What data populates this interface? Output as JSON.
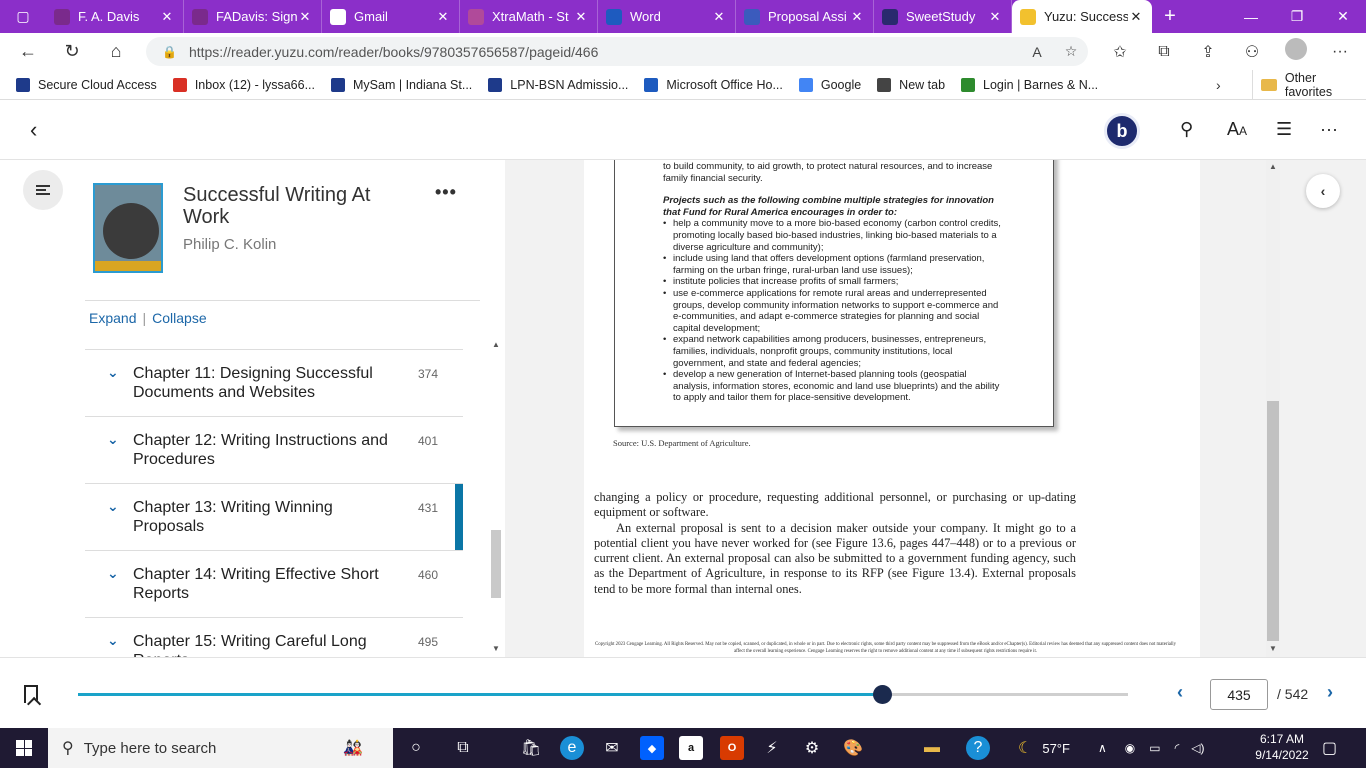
{
  "browser": {
    "tabs": [
      {
        "title": "F. A. Davis",
        "color": "#7a2a8c"
      },
      {
        "title": "FADavis: Sign",
        "color": "#7a2a8c"
      },
      {
        "title": "Gmail",
        "color": "#ffffff"
      },
      {
        "title": "XtraMath - St",
        "color": "#b04a9a"
      },
      {
        "title": "Word",
        "color": "#1e5bbf"
      },
      {
        "title": "Proposal Assi",
        "color": "#3b5bbd"
      },
      {
        "title": "SweetStudy",
        "color": "#2a2a6e"
      },
      {
        "title": "Yuzu: Success",
        "color": "#f2c12e"
      }
    ],
    "url": "https://reader.yuzu.com/reader/books/9780357656587/pageid/466",
    "favorites": [
      {
        "label": "Secure Cloud Access",
        "color": "#1e3a8a"
      },
      {
        "label": "Inbox (12) - lyssa66...",
        "color": "#d93025"
      },
      {
        "label": "MySam | Indiana St...",
        "color": "#1e3a8a"
      },
      {
        "label": "LPN-BSN Admissio...",
        "color": "#1e3a8a"
      },
      {
        "label": "Microsoft Office Ho...",
        "color": "#1e5bbf"
      },
      {
        "label": "Google",
        "color": "#4285f4"
      },
      {
        "label": "New tab",
        "color": "#444444"
      },
      {
        "label": "Login | Barnes & N...",
        "color": "#2e8b2e"
      }
    ],
    "other_favorites": "Other favorites"
  },
  "app": {
    "brand_letter": "b"
  },
  "book": {
    "title": "Successful Writing At Work",
    "author": "Philip C. Kolin",
    "expand": "Expand",
    "collapse": "Collapse",
    "separator": "|"
  },
  "toc": [
    {
      "title": "Chapter 11: Designing Successful Documents and Websites",
      "page": "374"
    },
    {
      "title": "Chapter 12: Writing Instructions and Procedures",
      "page": "401"
    },
    {
      "title": "Chapter 13: Writing Winning Proposals",
      "page": "431"
    },
    {
      "title": "Chapter 14: Writing Effective Short Reports",
      "page": "460"
    },
    {
      "title": "Chapter 15: Writing Careful Long Reports",
      "page": "495"
    }
  ],
  "page": {
    "fig_intro": "to build community, to aid growth, to protect natural resources, and to increase family financial security.",
    "fig_heading": "Projects such as the following combine multiple strategies for innovation that Fund for Rural America encourages in order to:",
    "fig_bullets": [
      "help a community move to a more bio-based economy (carbon control credits, promoting locally based bio-based industries, linking bio-based materials to a diverse agriculture and community);",
      "include using land that offers development options (farmland preservation, farming on the urban fringe, rural-urban land use issues);",
      "institute policies that increase profits of small farmers;",
      "use e-commerce applications for remote rural areas and underrepresented groups, develop community information networks to support e-commerce and e-communities, and adapt e-commerce strategies for planning and social capital development;",
      "expand network capabilities among producers, businesses, entrepreneurs, families, individuals, nonprofit groups, community institutions, local government, and state and federal agencies;",
      "develop a new generation of Internet-based planning tools (geospatial analysis, information stores, economic and land use blueprints) and the ability to apply and tailor them for place-sensitive development."
    ],
    "source": "Source: U.S. Department of Agriculture.",
    "para1": "changing a policy or procedure, requesting additional personnel, or purchasing or up-dating equipment or software.",
    "para2": "An external proposal is sent to a decision maker outside your company. It might go to a potential client you have never worked for (see Figure 13.6, pages 447–448) or to a previous or current client. An external proposal can also be submitted to a government funding agency, such as the Department of Agriculture, in response to its RFP (see Figure 13.4). External proposals tend to be more formal than internal ones.",
    "copyright": "Copyright 2023 Cengage Learning. All Rights Reserved. May not be copied, scanned, or duplicated, in whole or in part. Due to electronic rights, some third party content may be suppressed from the eBook and/or eChapter(s). Editorial review has deemed that any suppressed content does not materially affect the overall learning experience. Cengage Learning reserves the right to remove additional content at any time if subsequent rights restrictions require it."
  },
  "pager": {
    "current": "435",
    "total": "/ 542",
    "progress_percent": 76.6
  },
  "taskbar": {
    "search_placeholder": "Type here to search",
    "weather": "57°F",
    "time": "6:17 AM",
    "date": "9/14/2022"
  }
}
